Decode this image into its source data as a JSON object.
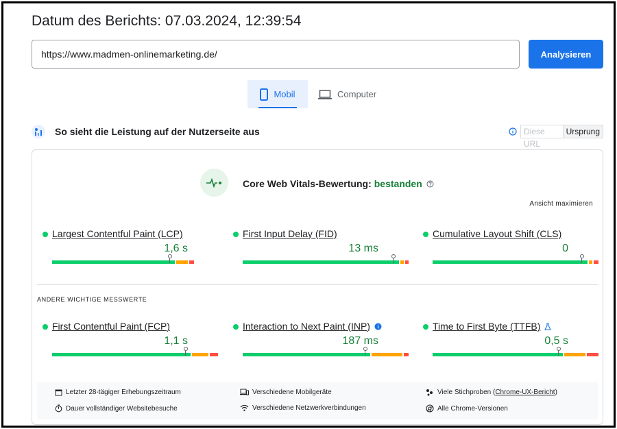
{
  "header": {
    "title": "Datum des Berichts: 07.03.2024, 12:39:54"
  },
  "search": {
    "url_value": "https://www.madmen-onlinemarketing.de/",
    "analyze_label": "Analysieren"
  },
  "tabs": [
    {
      "label": "Mobil",
      "active": true
    },
    {
      "label": "Computer",
      "active": false
    }
  ],
  "section": {
    "title": "So sieht die Leistung auf der Nutzerseite aus",
    "toggle_url": "Diese URL",
    "toggle_origin": "Ursprung"
  },
  "cwv": {
    "label": "Core Web Vitals-Bewertung:",
    "status": "bestanden",
    "expand": "Ansicht maximieren"
  },
  "core_metrics": [
    {
      "name": "Largest Contentful Paint (LCP)",
      "value": "1,6 s",
      "status_color": "#0cce6b",
      "dist": [
        0.75,
        0.07,
        0.03
      ]
    },
    {
      "name": "First Input Delay (FID)",
      "value": "13 ms",
      "status_color": "#0cce6b",
      "dist": [
        0.96,
        0.02,
        0.02
      ]
    },
    {
      "name": "Cumulative Layout Shift (CLS)",
      "value": "0",
      "status_color": "#0cce6b",
      "dist": [
        0.95,
        0.02,
        0.03
      ]
    }
  ],
  "other": {
    "label": "ANDERE WICHTIGE MESSWERTE",
    "metrics": [
      {
        "name": "First Contentful Paint (FCP)",
        "value": "1,1 s",
        "status_color": "#0cce6b",
        "dist": [
          0.85,
          0.1,
          0.05
        ]
      },
      {
        "name": "Interaction to Next Paint (INP)",
        "value": "187 ms",
        "status_color": "#0cce6b",
        "dist": [
          0.78,
          0.19,
          0.03
        ]
      },
      {
        "name": "Time to First Byte (TTFB)",
        "value": "0,5 s",
        "status_color": "#0cce6b",
        "dist": [
          0.8,
          0.13,
          0.07
        ]
      }
    ]
  },
  "footer": {
    "period": "Letzter 28-tägiger Erhebungszeitraum",
    "devices": "Verschiedene Mobilgeräte",
    "samples_prefix": "Viele Stichproben (",
    "samples_link": "Chrome-UX-Bericht",
    "samples_suffix": ")",
    "visits": "Dauer vollständiger Websitebesuche",
    "network": "Verschiedene Netzwerkverbindungen",
    "versions": "Alle Chrome-Versionen"
  },
  "colors": {
    "accent": "#1a73e8",
    "good": "#0cce6b",
    "needs_improvement": "#ffa400",
    "poor": "#ff4e42",
    "pass_text": "#188038"
  }
}
